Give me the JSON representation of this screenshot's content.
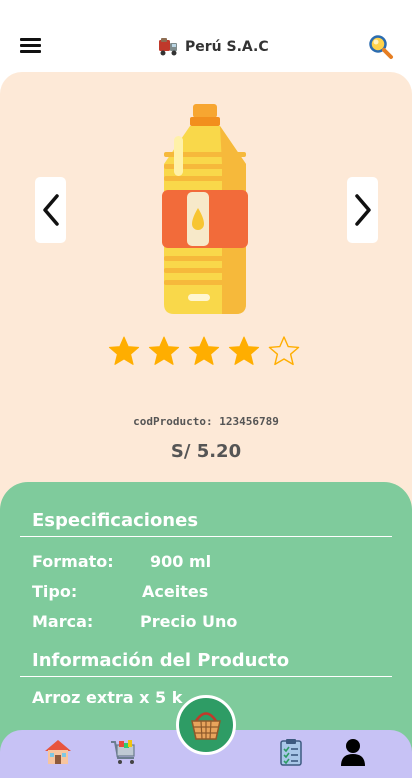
{
  "header": {
    "brand_name": "Perú S.A.C",
    "icons": {
      "menu": "hamburger-menu-icon",
      "logo": "delivery-truck-logo-icon",
      "search": "search-magnifier-icon"
    }
  },
  "product": {
    "image_icon": "oil-bottle-icon",
    "rating": 4,
    "rating_max": 5,
    "code_label": "codProducto:",
    "code_value": "123456789",
    "price": "S/ 5.20"
  },
  "specifications": {
    "title": "Especificaciones",
    "rows": [
      {
        "label": "Formato:",
        "value": "900 ml"
      },
      {
        "label": "Tipo:",
        "value": "Aceites"
      },
      {
        "label": "Marca:",
        "value": "Precio Uno"
      }
    ]
  },
  "product_info": {
    "title": "Información del Producto",
    "description": "Arroz extra x 5 k"
  },
  "tabbar": {
    "items": [
      "home-icon",
      "shopping-cart-icon",
      "basket-icon",
      "clipboard-list-icon",
      "user-icon"
    ]
  },
  "colors": {
    "hero_bg": "#fde9d7",
    "specs_bg": "#7fcb9c",
    "tabbar_bg": "#c7c2f5",
    "star": "#ffae00",
    "basket_bg": "#2e9c65"
  }
}
